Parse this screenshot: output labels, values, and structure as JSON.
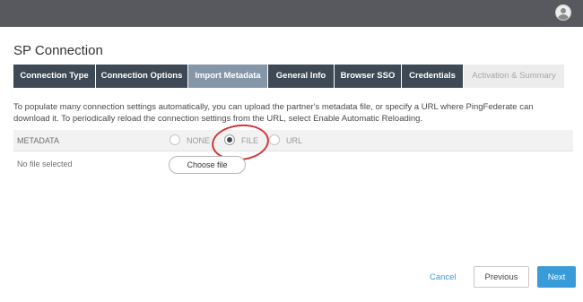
{
  "header": {
    "avatar_icon": "user-circle-icon",
    "bar_color": "#57595e"
  },
  "page": {
    "title": "SP Connection"
  },
  "tabs": [
    {
      "label": "Connection Type",
      "state": "completed"
    },
    {
      "label": "Connection Options",
      "state": "completed"
    },
    {
      "label": "Import Metadata",
      "state": "active"
    },
    {
      "label": "General Info",
      "state": "completed"
    },
    {
      "label": "Browser SSO",
      "state": "completed"
    },
    {
      "label": "Credentials",
      "state": "completed"
    },
    {
      "label": "Activation & Summary",
      "state": "disabled"
    }
  ],
  "instructions": "To populate many connection settings automatically, you can upload the partner's metadata file, or specify a URL where PingFederate can download it. To periodically reload the connection settings from the URL, select Enable Automatic Reloading.",
  "metadata": {
    "label": "METADATA",
    "options": [
      {
        "label": "NONE",
        "checked": false
      },
      {
        "label": "FILE",
        "checked": true
      },
      {
        "label": "URL",
        "checked": false
      }
    ],
    "selected": "FILE"
  },
  "file": {
    "status": "No file selected",
    "button_label": "Choose file"
  },
  "footer": {
    "cancel_label": "Cancel",
    "previous_label": "Previous",
    "next_label": "Next"
  },
  "colors": {
    "tab_dark": "#3d4a56",
    "tab_active": "#8596a8",
    "tab_disabled": "#ececec",
    "accent_blue": "#3a9bd9",
    "annotation_red": "#cf3a3a"
  }
}
